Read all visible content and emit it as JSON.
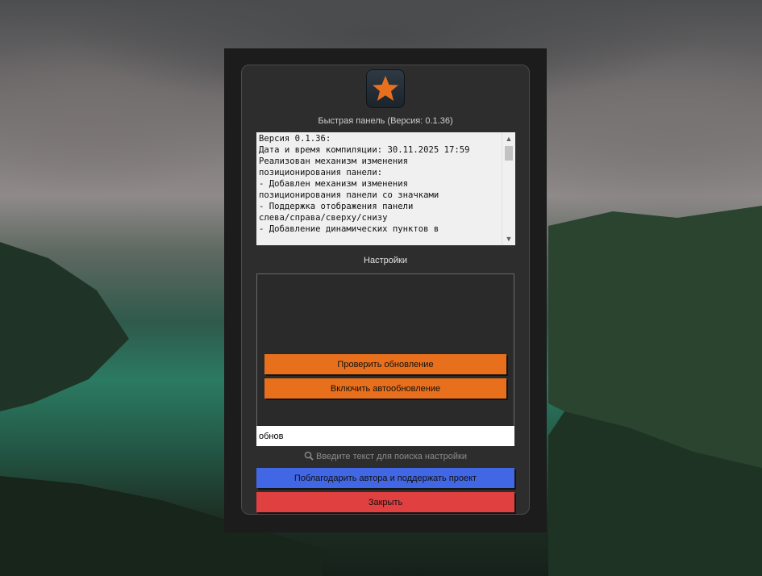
{
  "app": {
    "title": "Быстрая панель (Версия: 0.1.36)",
    "icon": "star-icon",
    "accent_color": "#e8701c"
  },
  "changelog": {
    "lines": [
      "Версия 0.1.36:",
      "Дата и время компиляции: 30.11.2025 17:59",
      "Реализован механизм изменения",
      "позиционирования панели:",
      "- Добавлен механизм изменения",
      "позиционирования панели со значками",
      "- Поддержка отображения панели",
      "слева/справа/сверху/снизу",
      "- Добавление динамических пунктов в"
    ]
  },
  "settings": {
    "label": "Настройки",
    "buttons": [
      {
        "label": "Проверить обновление"
      },
      {
        "label": "Включить автообновление"
      }
    ]
  },
  "search": {
    "value": "обнов",
    "hint": "Введите текст для поиска настройки"
  },
  "actions": {
    "support_label": "Поблагодарить автора и поддержать проект",
    "support_color": "#4267e4",
    "close_label": "Закрыть",
    "close_color": "#e04040"
  }
}
